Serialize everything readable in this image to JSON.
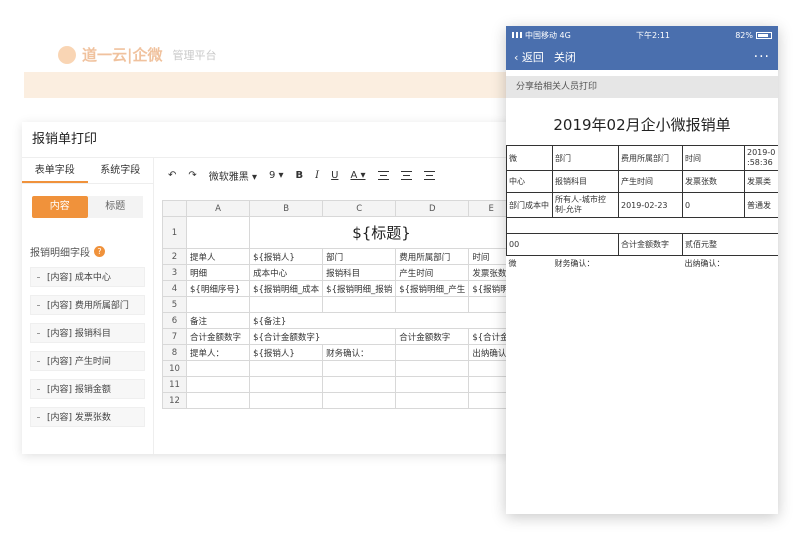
{
  "bg": {
    "brand": "道一云|企微",
    "sub": "管理平台"
  },
  "editor": {
    "title": "报销单打印",
    "side_tabs": [
      "表单字段",
      "系统字段"
    ],
    "seg": [
      "内容",
      "标题"
    ],
    "field_head": "报销明细字段",
    "fields": [
      "[内容] 成本中心",
      "[内容] 费用所属部门",
      "[内容] 报销科目",
      "[内容] 产生时间",
      "[内容] 报销金额",
      "[内容] 发票张数"
    ],
    "toolbar": {
      "undo": "↶",
      "redo": "↷",
      "font": "微软雅黑 ▾",
      "size": "9 ▾",
      "bold": "B",
      "italic": "I",
      "underline": "U",
      "color": "A ▾"
    },
    "columns": [
      "A",
      "B",
      "C",
      "D",
      "E"
    ],
    "rows": [
      {
        "n": "1",
        "title": "${标题}"
      },
      {
        "n": "2",
        "cells": [
          "提单人",
          "${报销人}",
          "部门",
          "费用所属部门",
          "时间"
        ]
      },
      {
        "n": "3",
        "cells": [
          "明细",
          "成本中心",
          "报销科目",
          "产生时间",
          "发票张数"
        ]
      },
      {
        "n": "4",
        "cells": [
          "${明细序号}",
          "${报销明细_成本",
          "${报销明细_报销",
          "${报销明细_产生",
          "${报销明"
        ]
      },
      {
        "n": "5",
        "cells": [
          "",
          "",
          "",
          "",
          ""
        ]
      },
      {
        "n": "6",
        "cells": [
          "备注",
          "${备注}",
          "",
          "",
          ""
        ]
      },
      {
        "n": "7",
        "cells": [
          "合计金额数字",
          "${合计金额数字}",
          "",
          "合计金额数字",
          "${合计金"
        ]
      },
      {
        "n": "8",
        "cells": [
          "提单人：",
          "${报销人}",
          "财务确认：",
          "",
          "出纳确认"
        ]
      },
      {
        "n": "10",
        "cells": [
          "",
          "",
          "",
          "",
          ""
        ]
      },
      {
        "n": "11",
        "cells": [
          "",
          "",
          "",
          "",
          ""
        ]
      },
      {
        "n": "12",
        "cells": [
          "",
          "",
          "",
          "",
          ""
        ]
      }
    ]
  },
  "phone": {
    "carrier": "中国移动",
    "network": "4G",
    "time": "下午2:11",
    "battery": "82%",
    "back": "返回",
    "close": "关闭",
    "more": "···",
    "share": "分享给相关人员打印",
    "doc_title": "2019年02月企小微报销单",
    "r1": [
      "微",
      "部门",
      "费用所属部门",
      "时间",
      "2019-0 :58:36"
    ],
    "r2": [
      "中心",
      "报销科目",
      "产生时间",
      "发票张数",
      "发票类"
    ],
    "r3": [
      "部门成本中",
      "所有人-城市控制-允许",
      "2019-02-23",
      "0",
      "普通发"
    ],
    "r4": [
      "00",
      "合计金额数字",
      "贰佰元整"
    ],
    "r5": [
      "微",
      "财务确认：",
      "出纳确认："
    ]
  }
}
